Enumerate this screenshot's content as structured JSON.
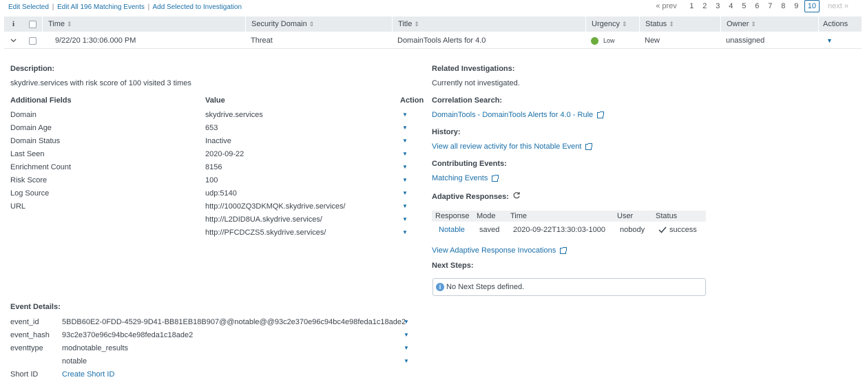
{
  "toolbar": {
    "edit_selected": "Edit Selected",
    "edit_all": "Edit All 196 Matching Events",
    "add_to_investigation": "Add Selected to Investigation",
    "separator": "|"
  },
  "pager": {
    "prev": "« prev",
    "pages": [
      "1",
      "2",
      "3",
      "4",
      "5",
      "6",
      "7",
      "8",
      "9",
      "10"
    ],
    "current": "10",
    "next": "next »"
  },
  "table": {
    "headers": {
      "info": "i",
      "time": "Time",
      "security_domain": "Security Domain",
      "title": "Title",
      "urgency": "Urgency",
      "status": "Status",
      "owner": "Owner",
      "actions": "Actions"
    },
    "sort_icon": "⇕",
    "row": {
      "time": "9/22/20 1:30:06.000 PM",
      "security_domain": "Threat",
      "title": "DomainTools Alerts for 4.0",
      "urgency": "Low",
      "status": "New",
      "owner": "unassigned"
    }
  },
  "details": {
    "description_label": "Description:",
    "description": "skydrive.services with risk score of 100 visited 3 times",
    "additional_fields_label": "Additional Fields",
    "value_label": "Value",
    "action_label": "Action",
    "fields": [
      {
        "name": "Domain",
        "value": "skydrive.services"
      },
      {
        "name": "Domain Age",
        "value": "653"
      },
      {
        "name": "Domain Status",
        "value": "Inactive"
      },
      {
        "name": "Last Seen",
        "value": "2020-09-22"
      },
      {
        "name": "Enrichment Count",
        "value": "8156"
      },
      {
        "name": "Risk Score",
        "value": "100"
      },
      {
        "name": "Log Source",
        "value": "udp:5140"
      },
      {
        "name": "URL",
        "value": "http://1000ZQ3DKMQK.skydrive.services/"
      },
      {
        "name": "",
        "value": "http://L2DID8UA.skydrive.services/"
      },
      {
        "name": "",
        "value": "http://PFCDCZS5.skydrive.services/"
      }
    ],
    "event_details_label": "Event Details:",
    "event_fields": [
      {
        "name": "event_id",
        "value": "5BDB60E2-0FDD-4529-9D41-BB81EB18B907@@notable@@93c2e370e96c94bc4e98feda1c18ade2"
      },
      {
        "name": "event_hash",
        "value": "93c2e370e96c94bc4e98feda1c18ade2"
      },
      {
        "name": "eventtype",
        "value": "modnotable_results"
      },
      {
        "name": "",
        "value": "notable"
      }
    ],
    "short_id_label": "Short ID",
    "short_id_link": "Create Short ID"
  },
  "right": {
    "related_label": "Related Investigations:",
    "related_value": "Currently not investigated.",
    "correlation_label": "Correlation Search:",
    "correlation_link": "DomainTools - DomainTools Alerts for 4.0 - Rule",
    "history_label": "History:",
    "history_link": "View all review activity for this Notable Event",
    "contributing_label": "Contributing Events:",
    "contributing_link": "Matching Events",
    "adaptive_label": "Adaptive Responses:",
    "ar_headers": {
      "response": "Response",
      "mode": "Mode",
      "time": "Time",
      "user": "User",
      "status": "Status"
    },
    "ar_row": {
      "response": "Notable",
      "mode": "saved",
      "time": "2020-09-22T13:30:03-1000",
      "user": "nobody",
      "status": "success"
    },
    "view_invocations": "View Adaptive Response Invocations",
    "next_steps_label": "Next Steps:",
    "next_steps_value": "No Next Steps defined."
  },
  "colors": {
    "accent": "#1a6fa8",
    "urgency_low": "#6cad3e",
    "header_bg": "#e8ebee"
  }
}
